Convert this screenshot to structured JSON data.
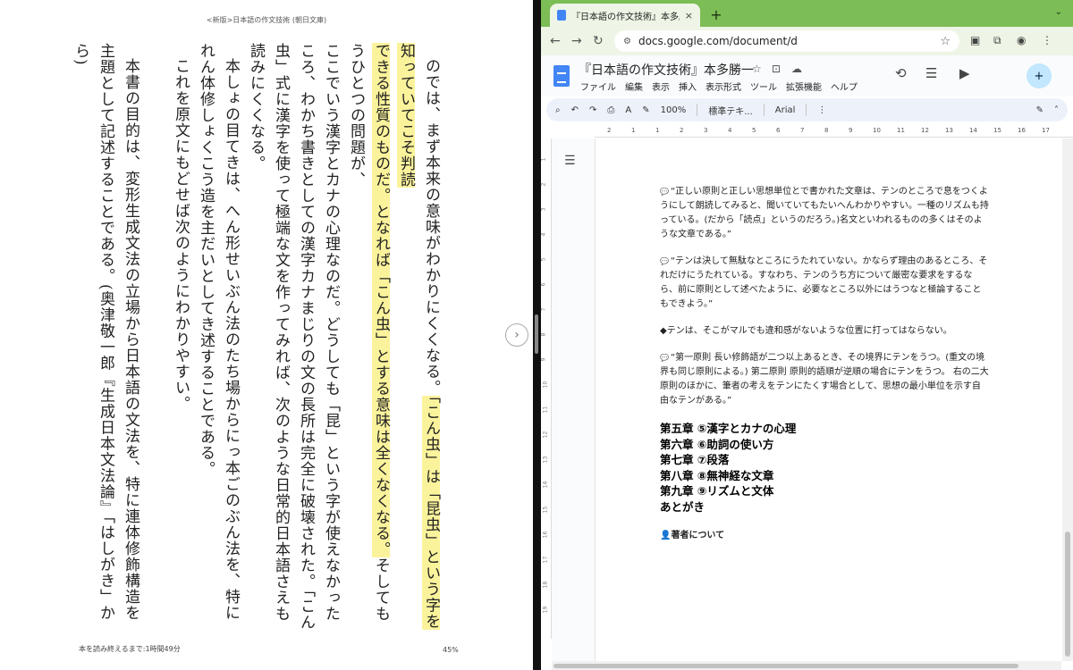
{
  "reader": {
    "book_title": "<新版>日本語の作文技術 (朝日文庫)",
    "lines": [
      "のでは、まず本来の意味がわかりにくくなる。",
      "「こん虫」は「昆虫」という字を知っていてこそ判読",
      "できる性質のものだ。",
      "となれば「こん虫」とする意味は全くなくなる。",
      "そしてもうひとつの問題が、",
      "ここでいう漢字とカナの心理なのだ。どうしても「昆」という字が使えなかったころ、わかち書きとしての漢字カナまじりの文の長所は完全に破壊された。「こん虫」式に漢字を使って極端な文を作ってみれば、次のような日常的日本語さえも読みにくくなる。",
      "本しょの目てきは、へん形せいぶん法のたち場からにっ本ごのぶん法を、特にれん体修しょくこう造を主だいとしてき述することである。",
      "これを原文にもどせば次のようにわかりやすい。",
      "本書の目的は、変形生成文法の立場から日本語の文法を、特に連体修飾構造を主題として記述することである。(奥津敬一郎『生成日本文法論』「はしがき」から)"
    ],
    "remaining_time": "本を読み終えるまで:1時間49分",
    "progress_percent": "45%",
    "next_page_icon": "chevron-right"
  },
  "browser": {
    "tab_title": "『日本語の作文技術』本多勝一 -",
    "tab_close": "×",
    "new_tab": "+",
    "url": "docs.google.com/document/d",
    "accent_color": "#7cbd55"
  },
  "docs": {
    "title": "『日本語の作文技術』本多勝一",
    "menu": [
      "ファイル",
      "編集",
      "表示",
      "挿入",
      "表示形式",
      "ツール",
      "拡張機能",
      "ヘルプ"
    ],
    "toolbar": {
      "zoom": "100%",
      "style": "標準テキ...",
      "font": "Arial"
    },
    "ruler_ticks": [
      "2",
      "1",
      "1",
      "2",
      "3",
      "4",
      "5",
      "6",
      "7",
      "8",
      "9",
      "10",
      "11",
      "12",
      "13",
      "14",
      "15",
      "16",
      "17"
    ],
    "left_ruler_ticks": [
      "1",
      "2",
      "3",
      "4",
      "5",
      "6",
      "7",
      "8",
      "9",
      "10",
      "11",
      "12",
      "13",
      "14",
      "15",
      "16",
      "17",
      "18",
      "19"
    ],
    "paragraphs": [
      "“正しい原則と正しい思想単位とで書かれた文章は、テンのところで息をつくようにして朗読してみると、聞いていてもたいへんわかりやすい。一種のリズムも持っている。(だから「読点」というのだろう。)名文といわれるものの多くはそのような文章である。”",
      "“テンは決して無駄なところにうたれていない。かならず理由のあるところ、それだけにうたれている。すなわち、テンのうち方について厳密な要求をするなら、前に原則として述べたように、必要なところ以外にはうつなと極論することもできよう。”",
      "◆テンは、そこがマルでも違和感がないような位置に打ってはならない。",
      "“第一原則 長い修飾語が二つ以上あるとき、その境界にテンをうつ。(重文の境界も同じ原則による。) 第二原則 原則的語順が逆順の場合にテンをうつ。 右の二大原則のほかに、筆者の考えをテンにたくす場合として、思想の最小単位を示す自由なテンがある。”"
    ],
    "chapters": [
      "第五章 ⑤漢字とカナの心理",
      "第六章 ⑥助詞の使い方",
      "第七章 ⑦段落",
      "第八章 ⑧無神経な文章",
      "第九章 ⑨リズムと文体",
      "あとがき"
    ],
    "author_heading": "著者について"
  }
}
